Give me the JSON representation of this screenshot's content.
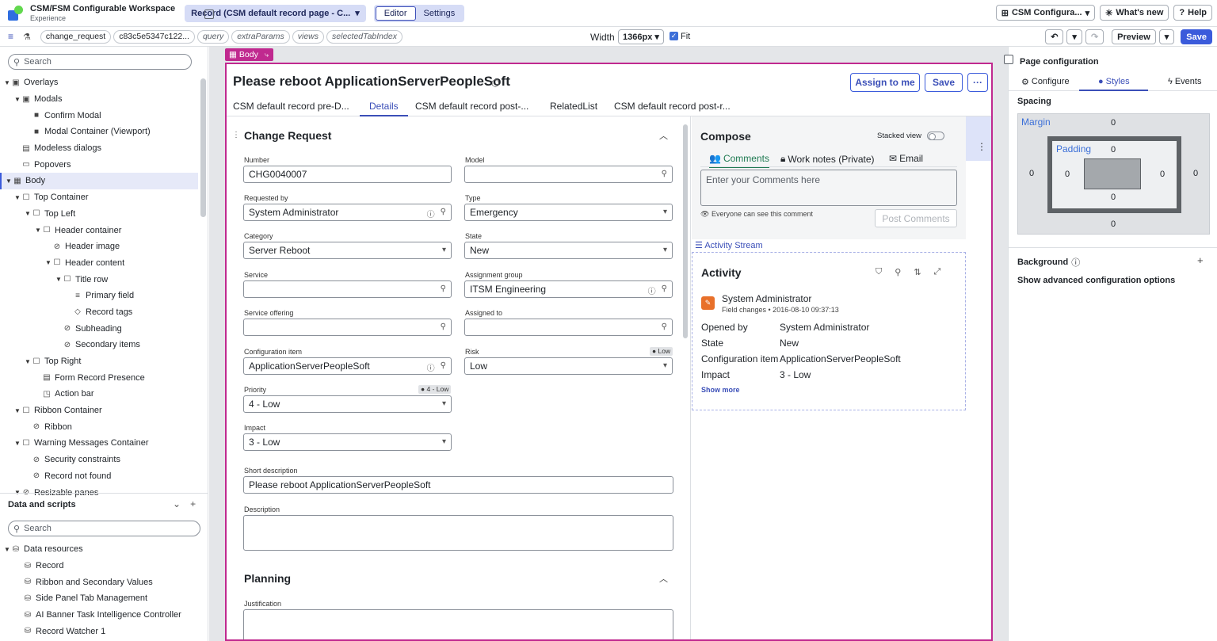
{
  "app": {
    "title": "CSM/FSM Configurable Workspace",
    "subtitle": "Experience"
  },
  "page_selector": "Record (CSM default record page - C...",
  "mode_tabs": [
    "Editor",
    "Settings"
  ],
  "top_right": {
    "config": "CSM Configura...",
    "whats_new": "What's new",
    "help": "Help"
  },
  "url_params": [
    "change_request",
    "c83c5e5347c122...",
    "query",
    "extraParams",
    "views",
    "selectedTabIndex"
  ],
  "width": {
    "label": "Width",
    "value": "1366px",
    "fit": "Fit"
  },
  "actions": {
    "preview": "Preview",
    "save": "Save"
  },
  "left": {
    "search_placeholder": "Search",
    "tree": [
      {
        "label": "Overlays",
        "depth": 0,
        "twist": "▼",
        "icon": "▣"
      },
      {
        "label": "Modals",
        "depth": 1,
        "twist": "▼",
        "icon": "▣"
      },
      {
        "label": "Confirm Modal",
        "depth": 2,
        "twist": "",
        "icon": "■"
      },
      {
        "label": "Modal Container (Viewport)",
        "depth": 2,
        "twist": "",
        "icon": "■"
      },
      {
        "label": "Modeless dialogs",
        "depth": 1,
        "twist": "",
        "icon": "▤"
      },
      {
        "label": "Popovers",
        "depth": 1,
        "twist": "",
        "icon": "▭"
      },
      {
        "label": "Body",
        "depth": 0,
        "twist": "▼",
        "icon": "▦",
        "selected": true
      },
      {
        "label": "Top Container",
        "depth": 1,
        "twist": "▼",
        "icon": "☐"
      },
      {
        "label": "Top Left",
        "depth": 2,
        "twist": "▼",
        "icon": "☐"
      },
      {
        "label": "Header container",
        "depth": 3,
        "twist": "▼",
        "icon": "☐"
      },
      {
        "label": "Header image",
        "depth": 4,
        "twist": "",
        "icon": "⊘"
      },
      {
        "label": "Header content",
        "depth": 4,
        "twist": "▼",
        "icon": "☐"
      },
      {
        "label": "Title row",
        "depth": 5,
        "twist": "▼",
        "icon": "☐"
      },
      {
        "label": "Primary field",
        "depth": 6,
        "twist": "",
        "icon": "≡"
      },
      {
        "label": "Record tags",
        "depth": 6,
        "twist": "",
        "icon": "◇"
      },
      {
        "label": "Subheading",
        "depth": 5,
        "twist": "",
        "icon": "⊘"
      },
      {
        "label": "Secondary items",
        "depth": 5,
        "twist": "",
        "icon": "⊘"
      },
      {
        "label": "Top Right",
        "depth": 2,
        "twist": "▼",
        "icon": "☐"
      },
      {
        "label": "Form Record Presence",
        "depth": 3,
        "twist": "",
        "icon": "▤"
      },
      {
        "label": "Action bar",
        "depth": 3,
        "twist": "",
        "icon": "◳"
      },
      {
        "label": "Ribbon Container",
        "depth": 1,
        "twist": "▼",
        "icon": "☐"
      },
      {
        "label": "Ribbon",
        "depth": 2,
        "twist": "",
        "icon": "⊘"
      },
      {
        "label": "Warning Messages Container",
        "depth": 1,
        "twist": "▼",
        "icon": "☐"
      },
      {
        "label": "Security constraints",
        "depth": 2,
        "twist": "",
        "icon": "⊘"
      },
      {
        "label": "Record not found",
        "depth": 2,
        "twist": "",
        "icon": "⊘"
      },
      {
        "label": "Resizable panes",
        "depth": 1,
        "twist": "▼",
        "icon": "⊘"
      }
    ],
    "data_title": "Data and scripts",
    "data_search": "Search",
    "data_tree": [
      {
        "label": "Data resources",
        "depth": 0,
        "twist": "▼",
        "icon": "⛁"
      },
      {
        "label": "Record",
        "depth": 1,
        "twist": "",
        "icon": "⛁"
      },
      {
        "label": "Ribbon and Secondary Values",
        "depth": 1,
        "twist": "",
        "icon": "⛁"
      },
      {
        "label": "Side Panel Tab Management",
        "depth": 1,
        "twist": "",
        "icon": "⛁"
      },
      {
        "label": "AI Banner Task Intelligence Controller",
        "depth": 1,
        "twist": "",
        "icon": "⛁"
      },
      {
        "label": "Record Watcher 1",
        "depth": 1,
        "twist": "",
        "icon": "⛁"
      }
    ]
  },
  "canvas": {
    "body_tag": "Body",
    "record_title": "Please reboot ApplicationServerPeopleSoft",
    "assign_btn": "Assign to me",
    "save_btn": "Save",
    "tabs": [
      "CSM default record pre-D...",
      "Details",
      "CSM default record post-...",
      "RelatedList",
      "CSM default record post-r..."
    ],
    "section1": "Change Request",
    "fields": {
      "number": {
        "label": "Number",
        "value": "CHG0040007"
      },
      "model": {
        "label": "Model",
        "value": ""
      },
      "requested_by": {
        "label": "Requested by",
        "value": "System Administrator"
      },
      "type": {
        "label": "Type",
        "value": "Emergency"
      },
      "category": {
        "label": "Category",
        "value": "Server Reboot"
      },
      "state": {
        "label": "State",
        "value": "New"
      },
      "service": {
        "label": "Service",
        "value": ""
      },
      "assignment_group": {
        "label": "Assignment group",
        "value": "ITSM Engineering"
      },
      "service_offering": {
        "label": "Service offering",
        "value": ""
      },
      "assigned_to": {
        "label": "Assigned to",
        "value": ""
      },
      "config_item": {
        "label": "Configuration item",
        "value": "ApplicationServerPeopleSoft"
      },
      "risk": {
        "label": "Risk",
        "value": "Low",
        "badge": "Low"
      },
      "priority": {
        "label": "Priority",
        "value": "4 - Low",
        "badge": "4 - Low"
      },
      "impact": {
        "label": "Impact",
        "value": "3 - Low"
      },
      "short_description": {
        "label": "Short description",
        "value": "Please reboot ApplicationServerPeopleSoft"
      },
      "description": {
        "label": "Description",
        "value": ""
      }
    },
    "section2": "Planning",
    "justification": "Justification",
    "compose": {
      "title": "Compose",
      "stacked": "Stacked view",
      "tabs": [
        "Comments",
        "Work notes (Private)",
        "Email"
      ],
      "placeholder": "Enter your Comments here",
      "visibility": "Everyone can see this comment",
      "post": "Post Comments"
    },
    "activity_stream": "Activity Stream",
    "activity": {
      "title": "Activity",
      "user": "System Administrator",
      "meta": "Field changes • 2016-08-10 09:37:13",
      "rows": [
        {
          "k": "Opened by",
          "v": "System Administrator"
        },
        {
          "k": "State",
          "v": "New"
        },
        {
          "k": "Configuration item",
          "v": "ApplicationServerPeopleSoft"
        },
        {
          "k": "Impact",
          "v": "3 - Low"
        }
      ],
      "show_more": "Show more"
    }
  },
  "right": {
    "title": "Page configuration",
    "tabs": [
      "Configure",
      "Styles",
      "Events"
    ],
    "spacing": "Spacing",
    "margin_label": "Margin",
    "padding_label": "Padding",
    "margin": {
      "top": "0",
      "right": "0",
      "bottom": "0",
      "left": "0"
    },
    "padding": {
      "top": "0",
      "right": "0",
      "bottom": "0",
      "left": "0"
    },
    "background": "Background",
    "advanced": "Show advanced configuration options"
  }
}
